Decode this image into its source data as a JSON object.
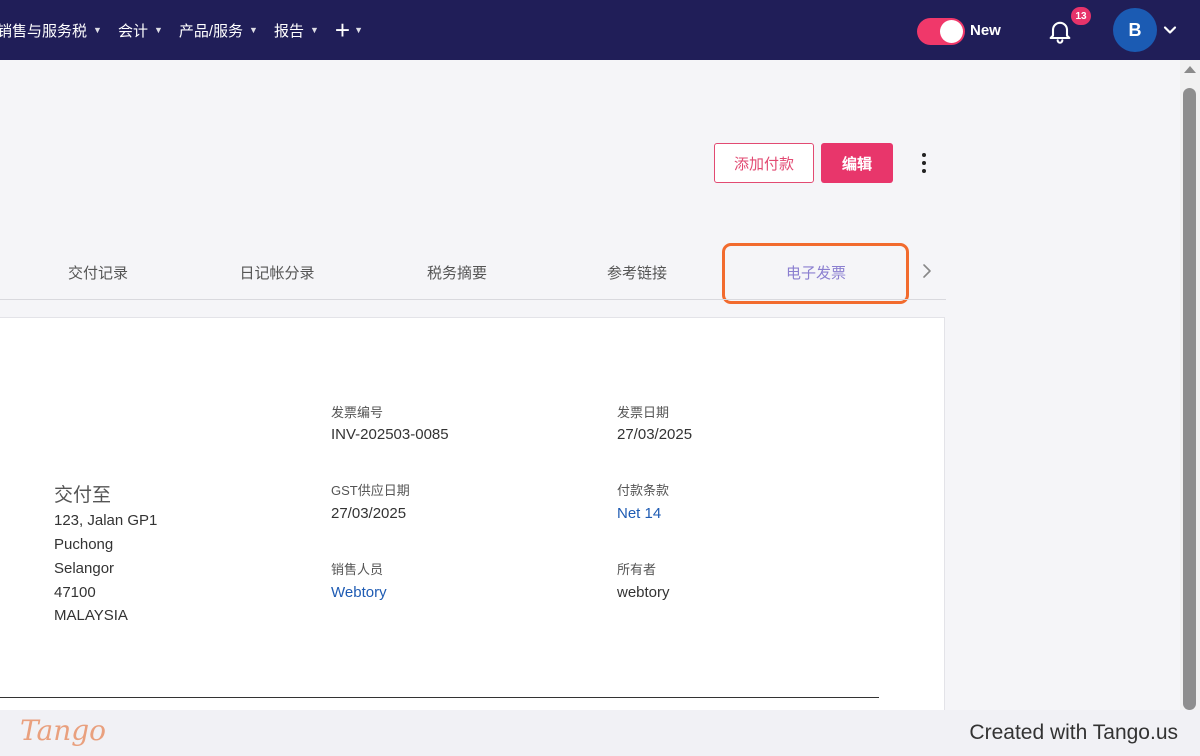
{
  "nav": {
    "items": [
      {
        "label": "销售与服务税"
      },
      {
        "label": "会计"
      },
      {
        "label": "产品/服务"
      },
      {
        "label": "报告"
      }
    ],
    "plus_label": "+",
    "toggle_label": "New",
    "notification_count": "13",
    "avatar_initial": "B"
  },
  "actions": {
    "add_payment": "添加付款",
    "edit": "编辑"
  },
  "tabs": [
    {
      "label": "交付记录"
    },
    {
      "label": "日记帐分录"
    },
    {
      "label": "税务摘要"
    },
    {
      "label": "参考链接"
    },
    {
      "label": "电子发票",
      "active": true
    }
  ],
  "invoice": {
    "number_label": "发票编号",
    "number": "INV-202503-0085",
    "date_label": "发票日期",
    "date": "27/03/2025",
    "gst_label": "GST供应日期",
    "gst_date": "27/03/2025",
    "terms_label": "付款条款",
    "terms": "Net 14",
    "sales_label": "销售人员",
    "sales": "Webtory",
    "owner_label": "所有者",
    "owner": "webtory"
  },
  "ship_to": {
    "title": "交付至",
    "lines": [
      "123, Jalan GP1",
      "Puchong",
      "Selangor",
      "47100",
      "MALAYSIA"
    ]
  },
  "footer": {
    "logo": "Tango",
    "created": "Created with Tango.us"
  },
  "colors": {
    "nav_bg": "#201e58",
    "accent": "#e8366b",
    "highlight": "#f26b2e",
    "link": "#1e5bb3",
    "avatar": "#1b5bb3"
  }
}
